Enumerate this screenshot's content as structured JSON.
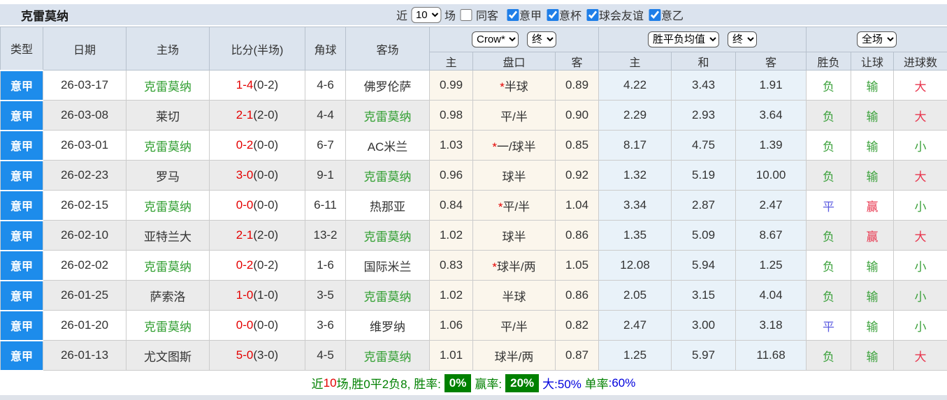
{
  "page": {
    "team_title": "克雷莫纳"
  },
  "topbar": {
    "recent_label": "近",
    "recent_value": "10",
    "matches_label": "场",
    "same_venue_label": "同客",
    "same_venue_checked": false,
    "filters": [
      {
        "label": "意甲",
        "checked": true
      },
      {
        "label": "意杯",
        "checked": true
      },
      {
        "label": "球会友谊",
        "checked": true
      },
      {
        "label": "意乙",
        "checked": true
      }
    ]
  },
  "table": {
    "headers": [
      "类型",
      "日期",
      "主场",
      "比分(半场)",
      "角球",
      "客场"
    ],
    "dropdowns": {
      "odds_source": "Crow*",
      "stage1": "终",
      "mean_label": "胜平负均值",
      "stage2": "终",
      "scope": "全场"
    },
    "sub_headers": [
      "主",
      "盘口",
      "客",
      "主",
      "和",
      "客",
      "胜负",
      "让球",
      "进球数"
    ],
    "rows": [
      {
        "league": "意甲",
        "date": "26-03-17",
        "home": "克雷莫纳",
        "home_main": true,
        "score": "1-4",
        "half": "(0-2)",
        "corners": "4-6",
        "away": "佛罗伦萨",
        "away_main": false,
        "odds1": "0.99",
        "handicap": "半球",
        "star": true,
        "odds2": "0.89",
        "avg_win": "4.22",
        "avg_draw": "3.43",
        "avg_lose": "1.91",
        "result": "负",
        "handicap_result": "输",
        "goals_result": "大"
      },
      {
        "league": "意甲",
        "date": "26-03-08",
        "home": "莱切",
        "home_main": false,
        "score": "2-1",
        "half": "(2-0)",
        "corners": "4-4",
        "away": "克雷莫纳",
        "away_main": true,
        "odds1": "0.98",
        "handicap": "平/半",
        "star": false,
        "odds2": "0.90",
        "avg_win": "2.29",
        "avg_draw": "2.93",
        "avg_lose": "3.64",
        "result": "负",
        "handicap_result": "输",
        "goals_result": "大"
      },
      {
        "league": "意甲",
        "date": "26-03-01",
        "home": "克雷莫纳",
        "home_main": true,
        "score": "0-2",
        "half": "(0-0)",
        "corners": "6-7",
        "away": "AC米兰",
        "away_main": false,
        "odds1": "1.03",
        "handicap": "一/球半",
        "star": true,
        "odds2": "0.85",
        "avg_win": "8.17",
        "avg_draw": "4.75",
        "avg_lose": "1.39",
        "result": "负",
        "handicap_result": "输",
        "goals_result": "小"
      },
      {
        "league": "意甲",
        "date": "26-02-23",
        "home": "罗马",
        "home_main": false,
        "score": "3-0",
        "half": "(0-0)",
        "corners": "9-1",
        "away": "克雷莫纳",
        "away_main": true,
        "odds1": "0.96",
        "handicap": "球半",
        "star": false,
        "odds2": "0.92",
        "avg_win": "1.32",
        "avg_draw": "5.19",
        "avg_lose": "10.00",
        "result": "负",
        "handicap_result": "输",
        "goals_result": "大"
      },
      {
        "league": "意甲",
        "date": "26-02-15",
        "home": "克雷莫纳",
        "home_main": true,
        "score": "0-0",
        "half": "(0-0)",
        "corners": "6-11",
        "away": "热那亚",
        "away_main": false,
        "odds1": "0.84",
        "handicap": "平/半",
        "star": true,
        "odds2": "1.04",
        "avg_win": "3.34",
        "avg_draw": "2.87",
        "avg_lose": "2.47",
        "result": "平",
        "handicap_result": "赢",
        "goals_result": "小"
      },
      {
        "league": "意甲",
        "date": "26-02-10",
        "home": "亚特兰大",
        "home_main": false,
        "score": "2-1",
        "half": "(2-0)",
        "corners": "13-2",
        "away": "克雷莫纳",
        "away_main": true,
        "odds1": "1.02",
        "handicap": "球半",
        "star": false,
        "odds2": "0.86",
        "avg_win": "1.35",
        "avg_draw": "5.09",
        "avg_lose": "8.67",
        "result": "负",
        "handicap_result": "赢",
        "goals_result": "大"
      },
      {
        "league": "意甲",
        "date": "26-02-02",
        "home": "克雷莫纳",
        "home_main": true,
        "score": "0-2",
        "half": "(0-2)",
        "corners": "1-6",
        "away": "国际米兰",
        "away_main": false,
        "odds1": "0.83",
        "handicap": "球半/两",
        "star": true,
        "odds2": "1.05",
        "avg_win": "12.08",
        "avg_draw": "5.94",
        "avg_lose": "1.25",
        "result": "负",
        "handicap_result": "输",
        "goals_result": "小"
      },
      {
        "league": "意甲",
        "date": "26-01-25",
        "home": "萨索洛",
        "home_main": false,
        "score": "1-0",
        "half": "(1-0)",
        "corners": "3-5",
        "away": "克雷莫纳",
        "away_main": true,
        "odds1": "1.02",
        "handicap": "半球",
        "star": false,
        "odds2": "0.86",
        "avg_win": "2.05",
        "avg_draw": "3.15",
        "avg_lose": "4.04",
        "result": "负",
        "handicap_result": "输",
        "goals_result": "小"
      },
      {
        "league": "意甲",
        "date": "26-01-20",
        "home": "克雷莫纳",
        "home_main": true,
        "score": "0-0",
        "half": "(0-0)",
        "corners": "3-6",
        "away": "维罗纳",
        "away_main": false,
        "odds1": "1.06",
        "handicap": "平/半",
        "star": false,
        "odds2": "0.82",
        "avg_win": "2.47",
        "avg_draw": "3.00",
        "avg_lose": "3.18",
        "result": "平",
        "handicap_result": "输",
        "goals_result": "小"
      },
      {
        "league": "意甲",
        "date": "26-01-13",
        "home": "尤文图斯",
        "home_main": false,
        "score": "5-0",
        "half": "(3-0)",
        "corners": "4-5",
        "away": "克雷莫纳",
        "away_main": true,
        "odds1": "1.01",
        "handicap": "球半/两",
        "star": false,
        "odds2": "0.87",
        "avg_win": "1.25",
        "avg_draw": "5.97",
        "avg_lose": "11.68",
        "result": "负",
        "handicap_result": "输",
        "goals_result": "大"
      }
    ]
  },
  "summary": {
    "segments": [
      {
        "text": "近",
        "style": "green"
      },
      {
        "text": "10",
        "style": "red"
      },
      {
        "text": "场,胜0平2负8, 胜率:",
        "style": "green"
      },
      {
        "text": "0%",
        "style": "badge"
      },
      {
        "text": "赢率:",
        "style": "green"
      },
      {
        "text": "20%",
        "style": "badge"
      },
      {
        "text": "大:50%",
        "style": "blue"
      },
      {
        "text": " 单率",
        "style": "green"
      },
      {
        "text": ":60%",
        "style": "blue"
      }
    ]
  },
  "colors": {
    "league_blue": "#1d8ceb",
    "team_green": "#2f9e2f",
    "score_red": "#e30000",
    "result_green": "#3ba13b",
    "result_red": "#e8364e",
    "result_blue": "#5b5be0",
    "badge_green": "#008000",
    "summary_green": "#008000",
    "summary_red": "#e30000",
    "summary_blue": "#0000dd",
    "header_bg": "#dce4ee",
    "row_alt_bg": "#ebebeb",
    "crow_col_bg": "#fbf6ec",
    "mean_col_bg": "#e9f2f9"
  }
}
